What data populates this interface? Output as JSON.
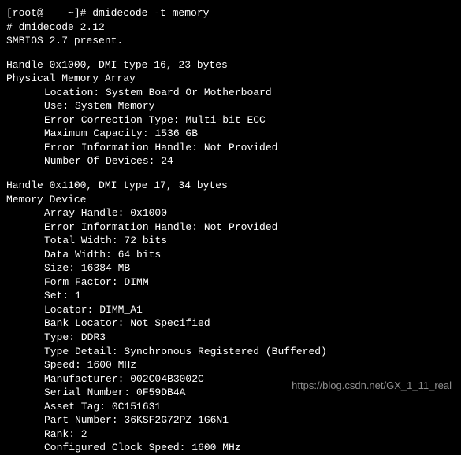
{
  "prompt_line": "[root@    ~]# dmidecode -t memory",
  "version_line": "# dmidecode 2.12",
  "smbios_line": "SMBIOS 2.7 present.",
  "section1": {
    "handle": "Handle 0x1000, DMI type 16, 23 bytes",
    "title": "Physical Memory Array",
    "fields": [
      "Location: System Board Or Motherboard",
      "Use: System Memory",
      "Error Correction Type: Multi-bit ECC",
      "Maximum Capacity: 1536 GB",
      "Error Information Handle: Not Provided",
      "Number Of Devices: 24"
    ]
  },
  "section2": {
    "handle": "Handle 0x1100, DMI type 17, 34 bytes",
    "title": "Memory Device",
    "fields": [
      "Array Handle: 0x1000",
      "Error Information Handle: Not Provided",
      "Total Width: 72 bits",
      "Data Width: 64 bits",
      "Size: 16384 MB",
      "Form Factor: DIMM",
      "Set: 1",
      "Locator: DIMM_A1",
      "Bank Locator: Not Specified",
      "Type: DDR3",
      "Type Detail: Synchronous Registered (Buffered)",
      "Speed: 1600 MHz",
      "Manufacturer: 002C04B3002C",
      "Serial Number: 0F59DB4A",
      "Asset Tag: 0C151631",
      "Part Number: 36KSF2G72PZ-1G6N1",
      "Rank: 2",
      "Configured Clock Speed: 1600 MHz"
    ]
  },
  "watermark": "https://blog.csdn.net/GX_1_11_real"
}
